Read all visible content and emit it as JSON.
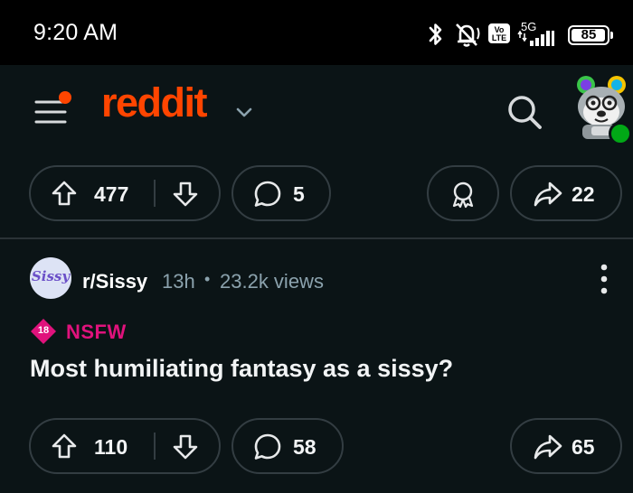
{
  "status_bar": {
    "time": "9:20 AM",
    "volte": "Vo\nLTE",
    "volte_top": "Vo",
    "volte_bottom": "LTE",
    "network": "5G",
    "battery": "85"
  },
  "header": {
    "logo": "reddit",
    "colors": {
      "brand": "#ff4500",
      "notification_dot": "#ff4500",
      "online": "#01a816"
    }
  },
  "post1": {
    "upvotes": "477",
    "comments": "5",
    "shares": "22"
  },
  "post2": {
    "subreddit": "r/Sissy",
    "subreddit_icon_text": "Sissy",
    "age": "13h",
    "separator": "•",
    "views": "23.2k views",
    "nsfw_badge_number": "18",
    "nsfw_label": "NSFW",
    "title": "Most humiliating fantasy as a sissy?",
    "upvotes": "110",
    "comments": "58",
    "shares": "65"
  }
}
